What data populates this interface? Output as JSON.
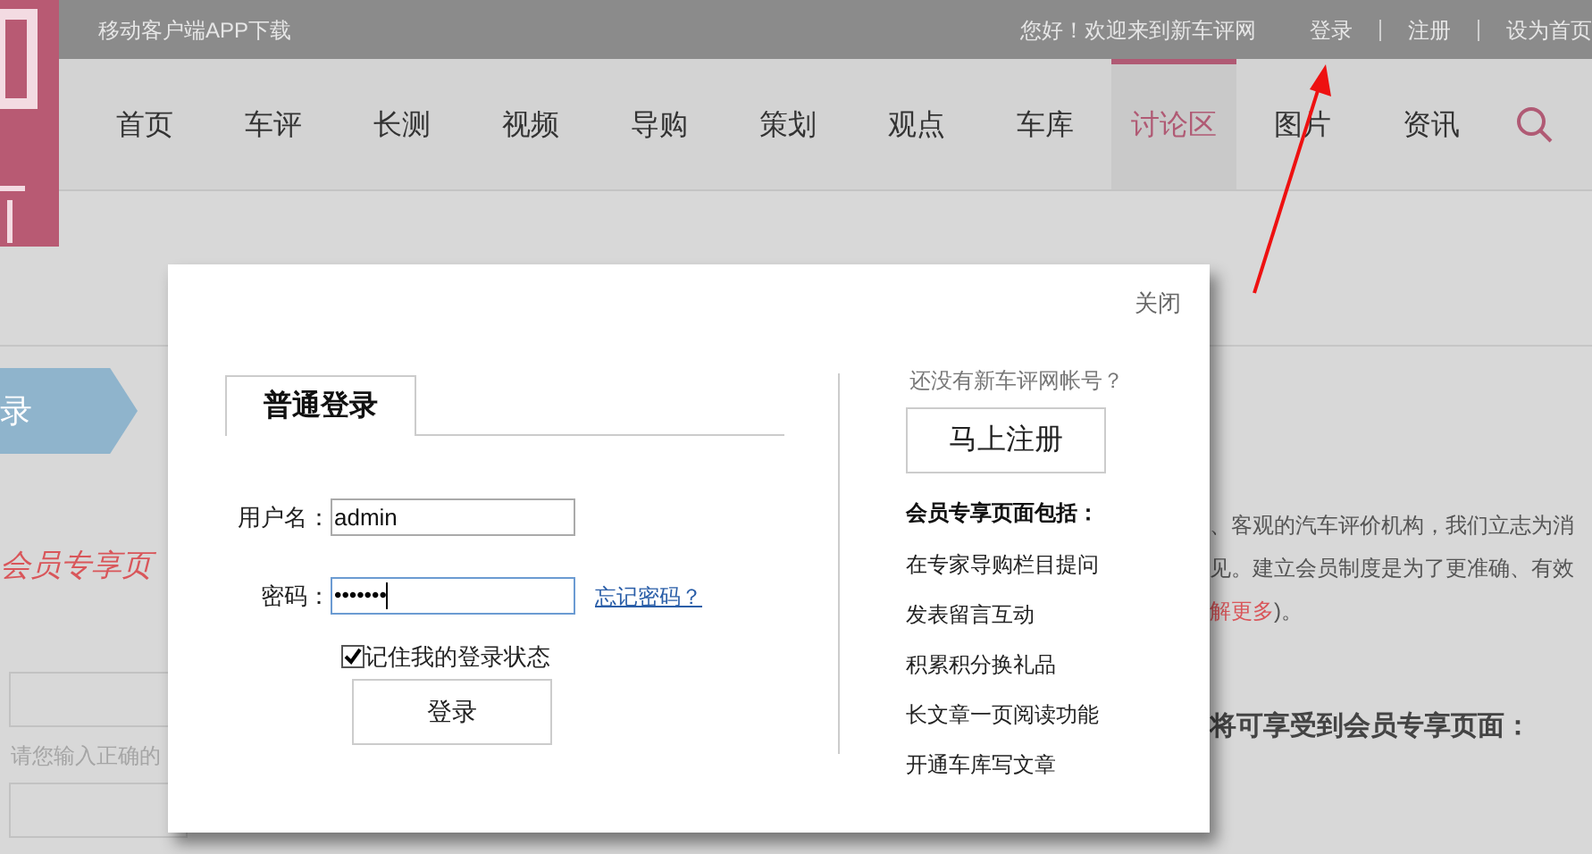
{
  "top_bar": {
    "app_download": "移动客户端APP下载",
    "welcome": "您好！欢迎来到新车评网",
    "links": [
      "登录",
      "注册",
      "设为首页"
    ]
  },
  "nav": {
    "items": [
      {
        "label": "首页",
        "selected": false
      },
      {
        "label": "车评",
        "selected": false
      },
      {
        "label": "长测",
        "selected": false
      },
      {
        "label": "视频",
        "selected": false
      },
      {
        "label": "导购",
        "selected": false
      },
      {
        "label": "策划",
        "selected": false
      },
      {
        "label": "观点",
        "selected": false
      },
      {
        "label": "车库",
        "selected": false
      },
      {
        "label": "讨论区",
        "selected": true
      },
      {
        "label": "图片",
        "selected": false
      },
      {
        "label": "资讯",
        "selected": false
      }
    ]
  },
  "page": {
    "step_label": "录",
    "heading": "会员专享页",
    "hint": "请您输入正确的",
    "intro_lines": [
      "、客观的汽车评价机构，我们立志为消",
      "见。建立会员制度是为了更准确、有效"
    ],
    "more_link": "解更多",
    "more_tail": ")。",
    "benefits_heading": "将可享受到会员专享页面："
  },
  "dialog": {
    "close": "关闭",
    "tab": "普通登录",
    "username_label": "用户名：",
    "username": "admin",
    "password_label": "密码：",
    "password": "•••••••",
    "forgot": "忘记密码？",
    "remember": {
      "label": "记住我的登录状态",
      "checked": true
    },
    "login_button": "登录",
    "no_account": "还没有新车评网帐号？",
    "register_button": "马上注册",
    "benefits_title": "会员专享页面包括：",
    "benefits": [
      "在专家导购栏目提问",
      "发表留言互动",
      "积累积分换礼品",
      "长文章一页阅读功能",
      "开通车库写文章"
    ]
  }
}
